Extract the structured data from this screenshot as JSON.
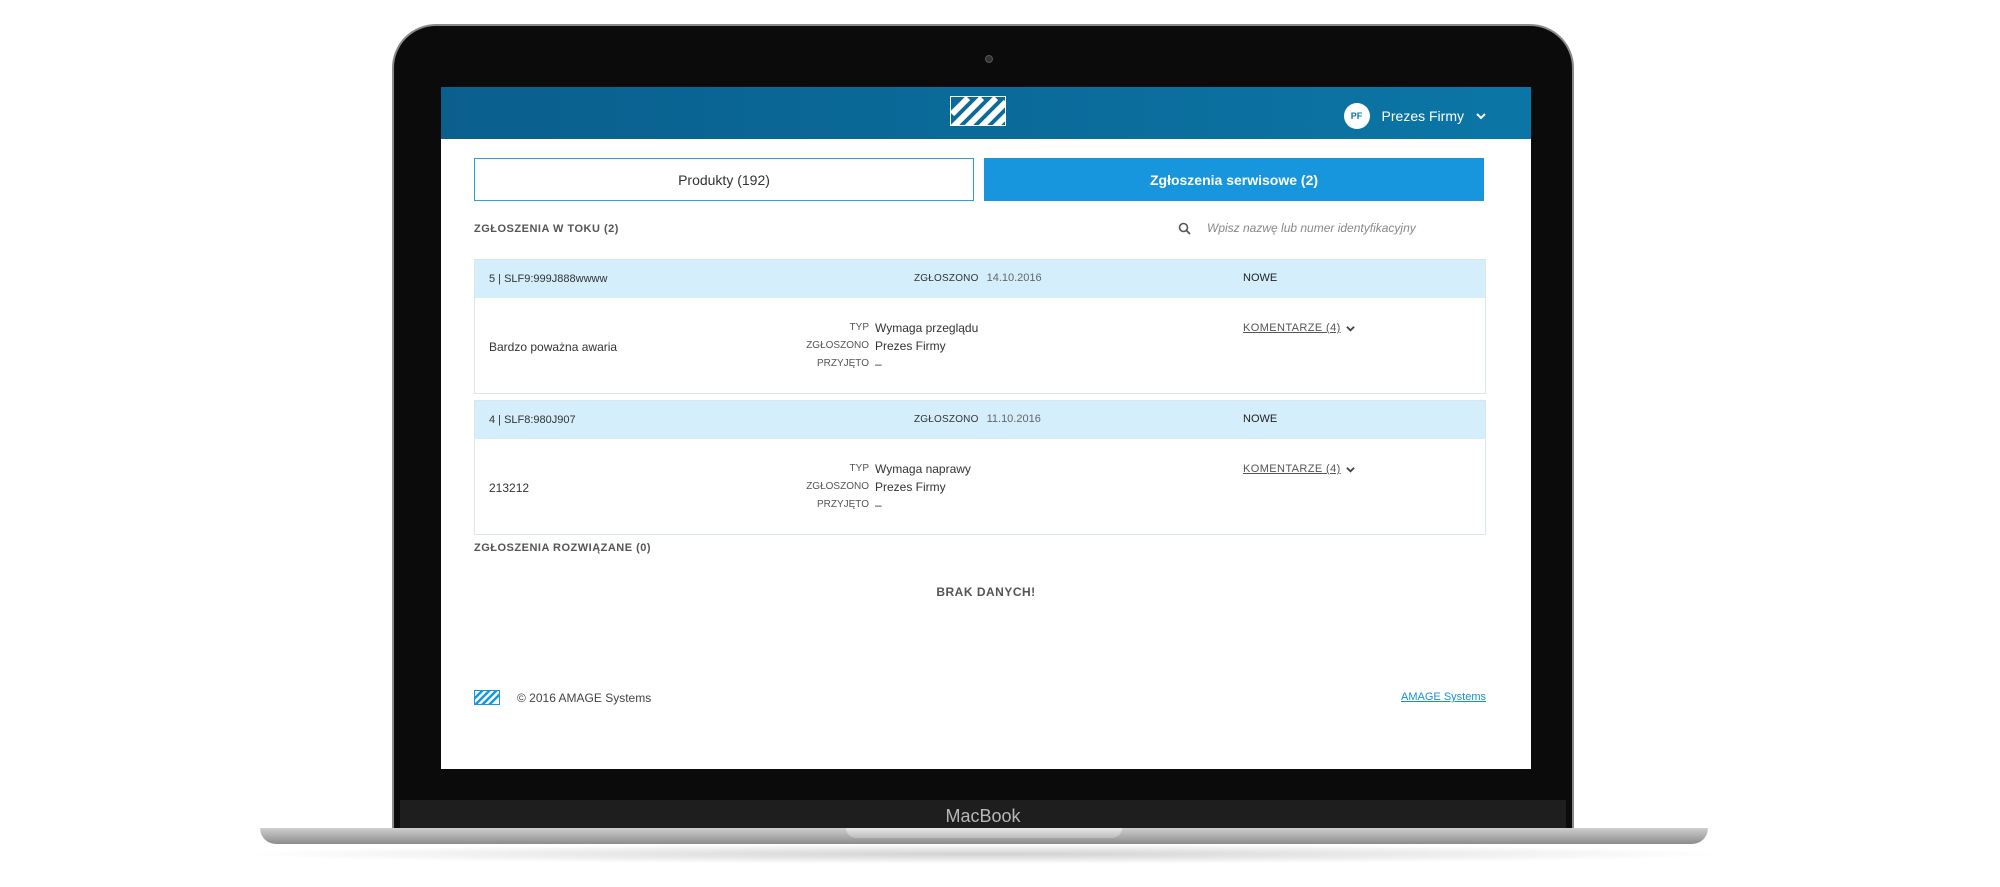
{
  "device": {
    "brand": "MacBook"
  },
  "header": {
    "user": {
      "initials": "PF",
      "name": "Prezes Firmy"
    }
  },
  "tabs": [
    {
      "label": "Produkty (192)",
      "active": false
    },
    {
      "label": "Zgłoszenia serwisowe (2)",
      "active": true
    }
  ],
  "in_progress": {
    "title": "ZGŁOSZENIA W TOKU (2)",
    "search_placeholder": "Wpisz nazwę lub numer identyfikacyjny",
    "items": [
      {
        "id": "5 | SLF9:999J888wwww",
        "reported_label": "ZGŁOSZONO",
        "reported_date": "14.10.2016",
        "status": "NOWE",
        "description": "Bardzo poważna awaria",
        "type_label": "TYP",
        "type_value": "Wymaga przeglądu",
        "reported_by_label": "ZGŁOSZONO",
        "reported_by_value": "Prezes Firmy",
        "accepted_label": "PRZYJĘTO",
        "accepted_value": "–",
        "comments": "KOMENTARZE (4)"
      },
      {
        "id": "4 | SLF8:980J907",
        "reported_label": "ZGŁOSZONO",
        "reported_date": "11.10.2016",
        "status": "NOWE",
        "description": "213212",
        "type_label": "TYP",
        "type_value": "Wymaga naprawy",
        "reported_by_label": "ZGŁOSZONO",
        "reported_by_value": "Prezes Firmy",
        "accepted_label": "PRZYJĘTO",
        "accepted_value": "–",
        "comments": "KOMENTARZE (4)"
      }
    ]
  },
  "resolved": {
    "title": "ZGŁOSZENIA ROZWIĄZANE (0)",
    "empty_text": "BRAK DANYCH!"
  },
  "footer": {
    "copyright": "© 2016 AMAGE Systems",
    "link": "AMAGE Systems"
  },
  "colors": {
    "header": "#0b76a6",
    "accent": "#1795dd",
    "card_head": "#d4effb",
    "link": "#1b8fd6"
  }
}
